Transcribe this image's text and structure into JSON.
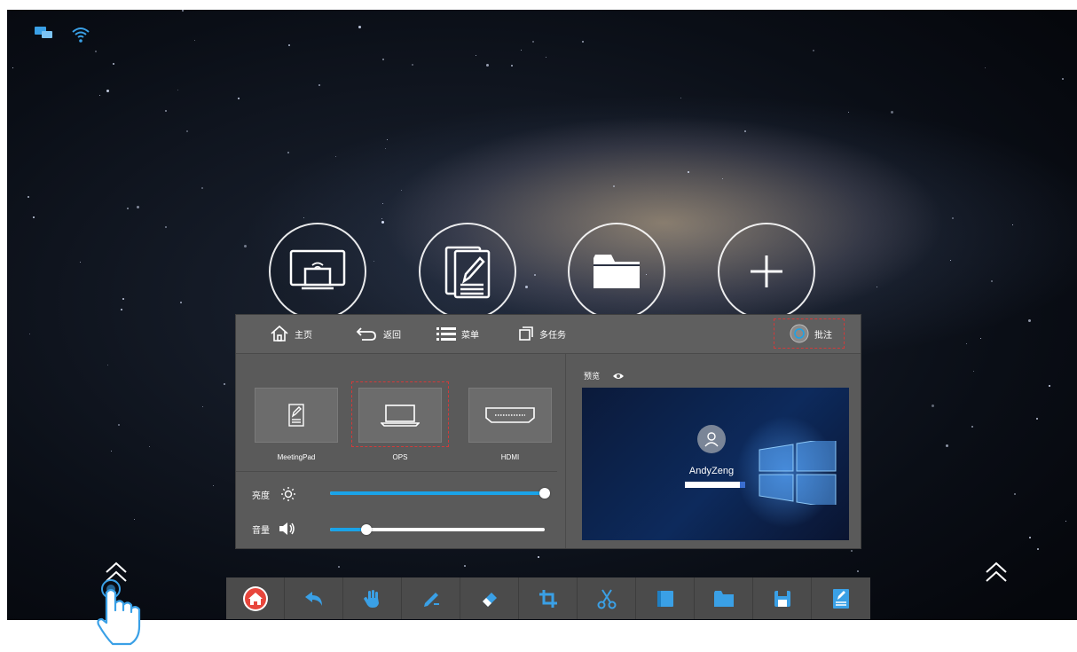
{
  "screen": {
    "accent_color": "#1aa3e8",
    "alert_color": "#d23a3a"
  },
  "status_bar": {
    "icons": [
      "screen-share-icon",
      "wifi-icon"
    ]
  },
  "apps": [
    {
      "name": "wireless-screen-cast-icon"
    },
    {
      "name": "document-notes-icon"
    },
    {
      "name": "folder-icon"
    },
    {
      "name": "add-icon"
    }
  ],
  "panel": {
    "top_bar": {
      "home_label": "主页",
      "back_label": "返回",
      "menu_label": "菜单",
      "multitask_label": "多任务",
      "annotate_label": "批注"
    },
    "sources": [
      {
        "label": "MeetingPad",
        "icon": "meetingpad-icon"
      },
      {
        "label": "OPS",
        "icon": "laptop-icon"
      },
      {
        "label": "HDMI",
        "icon": "hdmi-icon"
      }
    ],
    "brightness": {
      "label": "亮度",
      "value_percent": 100
    },
    "volume": {
      "label": "音量",
      "value_percent": 17
    },
    "preview": {
      "label": "预览",
      "user_name": "AndyZeng"
    }
  },
  "toolbar": {
    "tools": [
      "home-icon",
      "undo-icon",
      "hand-icon",
      "pen-icon",
      "eraser-icon",
      "crop-icon",
      "scissors-icon",
      "whiteboard-icon",
      "folder-icon",
      "save-icon",
      "notes-icon"
    ]
  }
}
